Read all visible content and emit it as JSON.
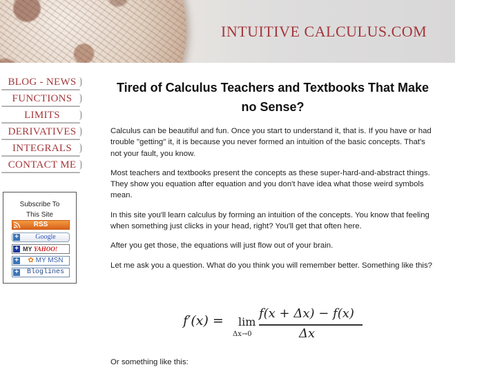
{
  "header": {
    "site_title": "INTUITIVE CALCULUS.COM",
    "brand_color": "#a3383c"
  },
  "nav": {
    "items": [
      {
        "label": "BLOG - NEWS"
      },
      {
        "label": "FUNCTIONS"
      },
      {
        "label": "LIMITS"
      },
      {
        "label": "DERIVATIVES"
      },
      {
        "label": "INTEGRALS"
      },
      {
        "label": "CONTACT ME"
      }
    ]
  },
  "subscribe": {
    "title_line1": "Subscribe To",
    "title_line2": "This Site",
    "buttons": {
      "rss": "RSS",
      "google": "Google",
      "yahoo_prefix": "MY",
      "yahoo": "YAHOO!",
      "msn": "MY MSN",
      "bloglines": "Bloglines"
    }
  },
  "main": {
    "headline": "Tired of Calculus Teachers and Textbooks That Make no Sense?",
    "paragraphs": [
      "Calculus can be beautiful and fun. Once you start to understand it, that is. If you have or had trouble \"getting\" it, it is because you never formed an intuition of the basic concepts. That's not your fault, you know.",
      "Most teachers and textbooks present the concepts as these super-hard-and-abstract things. They show you equation after equation and you don't have idea what those weird symbols mean.",
      "In this site you'll learn calculus by forming an intuition of the concepts. You know that feeling when something just clicks in your head, right? You'll get that often here.",
      "After you get those, the equations will just flow out of your brain.",
      "Let me ask you a question. What do you think you will remember better. Something like this?"
    ],
    "formula": {
      "lhs": "f′(x) =",
      "lim": "lim",
      "lim_sub": "Δx→0",
      "numerator": "f(x + Δx) − f(x)",
      "denominator": "Δx"
    },
    "after_formula": "Or something like this:"
  }
}
